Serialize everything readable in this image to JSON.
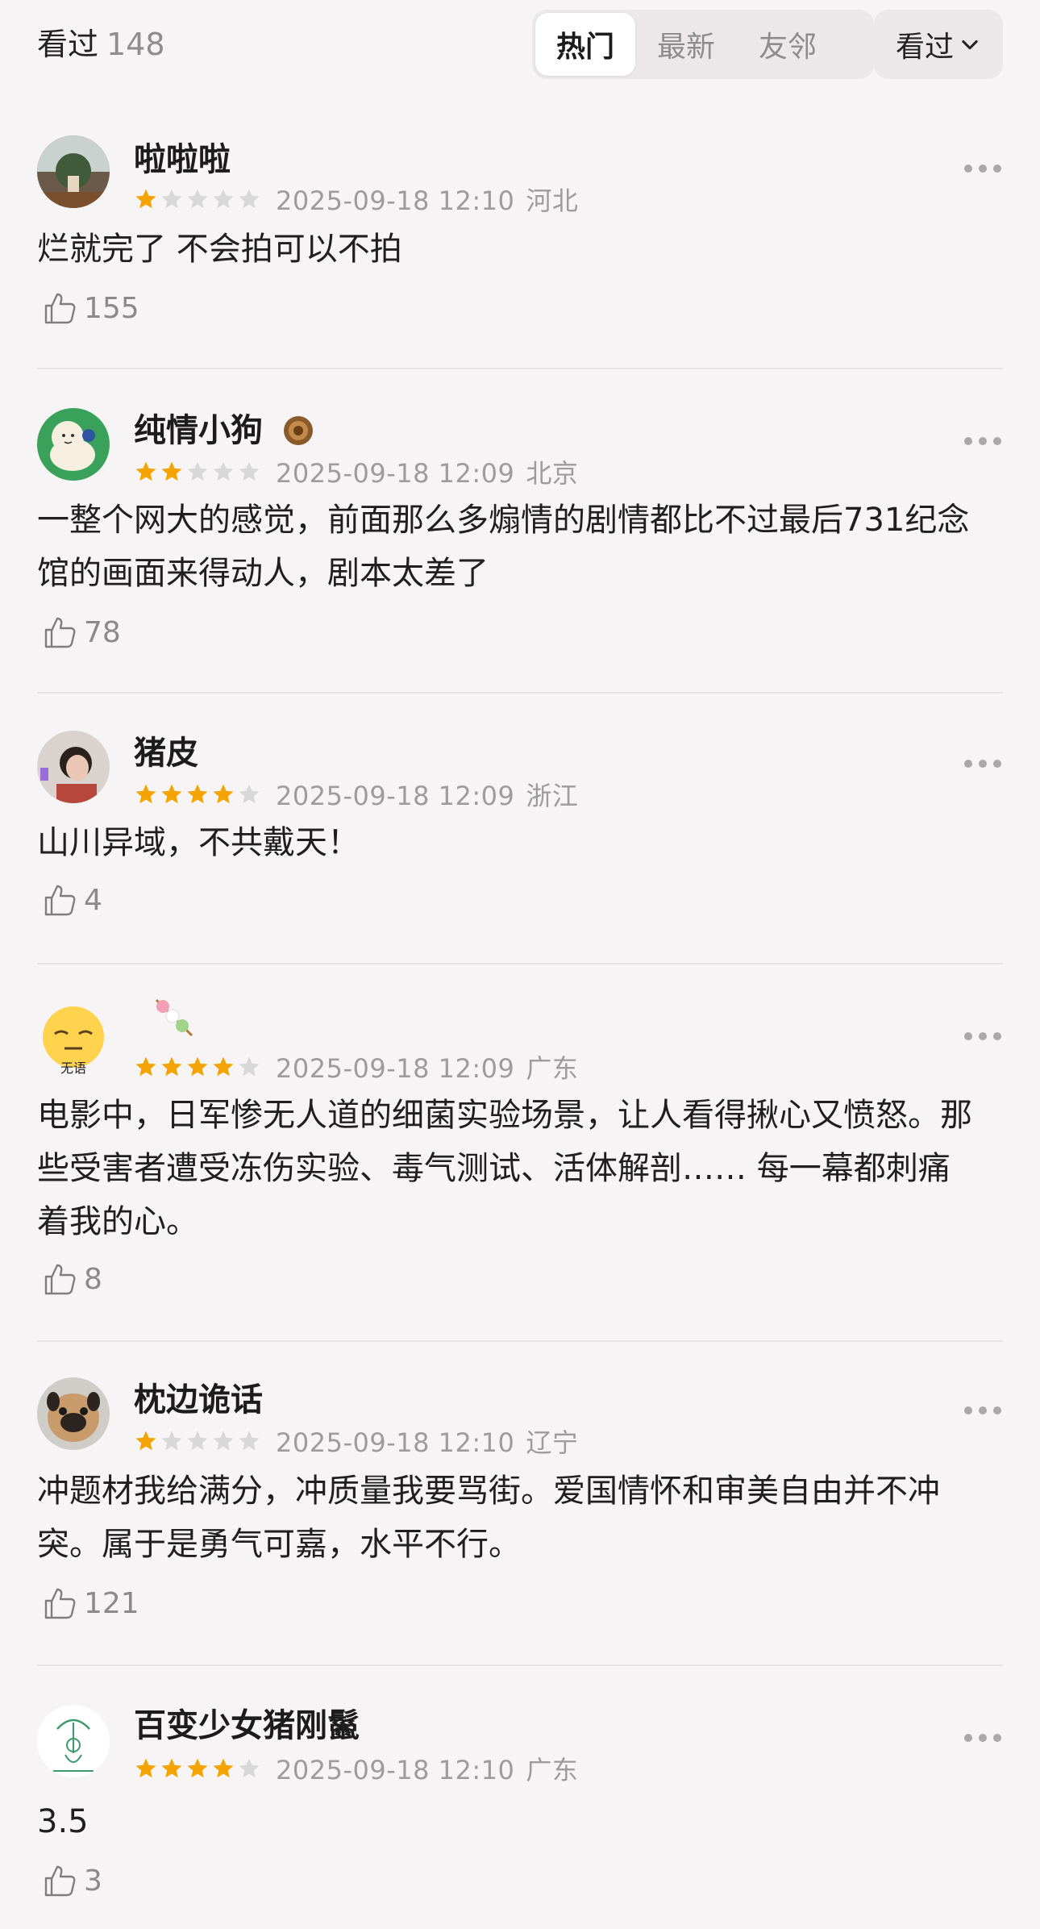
{
  "header": {
    "seen_label": "看过",
    "seen_count": "148",
    "tabs": [
      {
        "label": "热门",
        "active": true
      },
      {
        "label": "最新",
        "active": false
      },
      {
        "label": "友邻",
        "active": false
      }
    ],
    "filter_dropdown": "看过"
  },
  "colors": {
    "star_filled": "#f5a300",
    "star_empty": "#d8d8d8",
    "background": "#f7f4f5"
  },
  "comments": [
    {
      "name": "啦啦啦",
      "rating": 1,
      "time": "2025-09-18 12:10",
      "region": "河北",
      "text": "烂就完了 不会拍可以不拍",
      "likes": "155",
      "badge_icon": null
    },
    {
      "name": "纯情小狗",
      "rating": 2,
      "time": "2025-09-18 12:09",
      "region": "北京",
      "text": "一整个网大的感觉，前面那么多煽情的剧情都比不过最后731纪念馆的画面来得动人，剧本太差了",
      "likes": "78",
      "badge_icon": "medal-icon"
    },
    {
      "name": "猪皮",
      "rating": 4,
      "time": "2025-09-18 12:09",
      "region": "浙江",
      "text": "山川异域，不共戴天！",
      "likes": "4",
      "badge_icon": null
    },
    {
      "name": "",
      "rating": 4,
      "time": "2025-09-18 12:09",
      "region": "广东",
      "text": "电影中，日军惨无人道的细菌实验场景，让人看得揪心又愤怒。那些受害者遭受冻伤实验、毒气测试、活体解剖…… 每一幕都刺痛着我的心。",
      "likes": "8",
      "badge_icon": "dango-icon",
      "avatar_caption": "无语"
    },
    {
      "name": "枕边诡话",
      "rating": 1,
      "time": "2025-09-18 12:10",
      "region": "辽宁",
      "text": "冲题材我给满分，冲质量我要骂街。爱国情怀和审美自由并不冲突。属于是勇气可嘉，水平不行。",
      "likes": "121",
      "badge_icon": null
    },
    {
      "name": "百变少女猪刚鬣",
      "rating": 4,
      "time": "2025-09-18 12:10",
      "region": "广东",
      "text": "3.5",
      "likes": "3",
      "badge_icon": null
    }
  ]
}
